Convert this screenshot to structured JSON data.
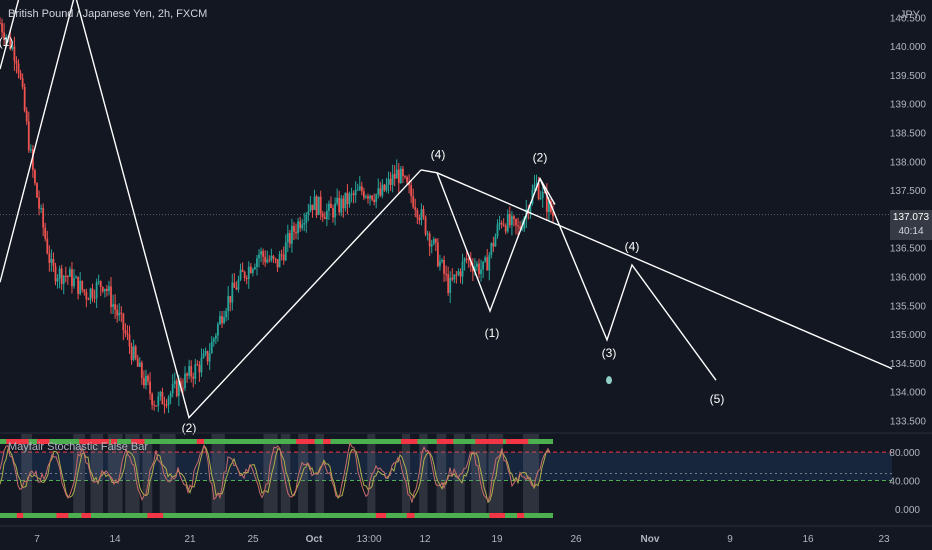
{
  "header": {
    "symbol_title": "British Pound / Japanese Yen, 2h, FXCM"
  },
  "price_axis": {
    "currency": "JPY",
    "ticks": [
      "140.500",
      "140.000",
      "139.500",
      "139.000",
      "138.500",
      "138.000",
      "137.500",
      "136.500",
      "136.000",
      "135.500",
      "135.000",
      "134.500",
      "134.000",
      "133.500"
    ],
    "last_price": "137.073",
    "countdown": "40:14"
  },
  "date_axis": {
    "ticks": [
      "7",
      "14",
      "21",
      "25",
      "Oct",
      "13:00",
      "12",
      "19",
      "26",
      "Nov",
      "9",
      "16",
      "23"
    ]
  },
  "indicator": {
    "title": "Mayfair Stochastic False Bar",
    "ticks": [
      "80.000",
      "40.000",
      "0.000"
    ]
  },
  "colors": {
    "background": "#131722",
    "up_candle": "#26a69a",
    "down_candle": "#ef5350",
    "wave_line": "#ffffff",
    "indicator_band": "#1e3a5f",
    "green_band": "#4caf50",
    "red_band": "#f23645"
  },
  "chart_data": [
    {
      "type": "line",
      "title": "British Pound / Japanese Yen, 2h, FXCM",
      "xlabel": "",
      "ylabel": "JPY",
      "ylim": [
        133.3,
        140.8
      ],
      "current_price": 137.073,
      "x_tick_labels": [
        "7",
        "14",
        "21",
        "25",
        "Oct",
        "13:00",
        "12",
        "19",
        "26",
        "Nov",
        "9",
        "16",
        "23"
      ],
      "y_tick_labels": [
        "140.500",
        "140.000",
        "139.500",
        "139.000",
        "138.500",
        "138.000",
        "137.500",
        "136.500",
        "136.000",
        "135.500",
        "135.000",
        "134.500",
        "134.000",
        "133.500"
      ],
      "series": [
        {
          "name": "Price (2h)",
          "points": [
            [
              "7",
              140.4
            ],
            [
              "9",
              139.8
            ],
            [
              "10",
              137.6
            ],
            [
              "11",
              136.1
            ],
            [
              "14",
              136.0
            ],
            [
              "15",
              135.7
            ],
            [
              "17",
              135.9
            ],
            [
              "18",
              135.2
            ],
            [
              "21",
              134.4
            ],
            [
              "22",
              133.8
            ],
            [
              "23",
              134.0
            ],
            [
              "24",
              134.3
            ],
            [
              "25",
              134.6
            ],
            [
              "28",
              135.5
            ],
            [
              "29",
              136.0
            ],
            [
              "30",
              136.4
            ],
            [
              "Oct",
              136.2
            ],
            [
              "2",
              136.8
            ],
            [
              "5",
              137.3
            ],
            [
              "6",
              137.1
            ],
            [
              "7",
              137.3
            ],
            [
              "8",
              137.5
            ],
            [
              "9",
              137.4
            ],
            [
              "12",
              137.8
            ],
            [
              "13",
              137.3
            ],
            [
              "14",
              136.6
            ],
            [
              "15",
              135.8
            ],
            [
              "16",
              136.3
            ],
            [
              "19",
              136.1
            ],
            [
              "20",
              137.0
            ],
            [
              "21",
              136.8
            ],
            [
              "22",
              137.6
            ],
            [
              "23",
              137.07
            ]
          ]
        },
        {
          "name": "Wave count",
          "labels": [
            "(1)",
            "(2)",
            "(4)",
            "(1)",
            "(2)",
            "(3)",
            "(4)",
            "(5)"
          ]
        }
      ],
      "annotations": [
        "(1)",
        "(2)",
        "(4)",
        "(1)",
        "(2)",
        "(3)",
        "(4)",
        "(5)"
      ]
    },
    {
      "type": "line",
      "title": "Mayfair Stochastic False Bar",
      "ylim": [
        -10,
        100
      ],
      "levels": [
        80,
        40,
        0
      ],
      "y_tick_labels": [
        "80.000",
        "40.000",
        "0.000"
      ]
    }
  ]
}
